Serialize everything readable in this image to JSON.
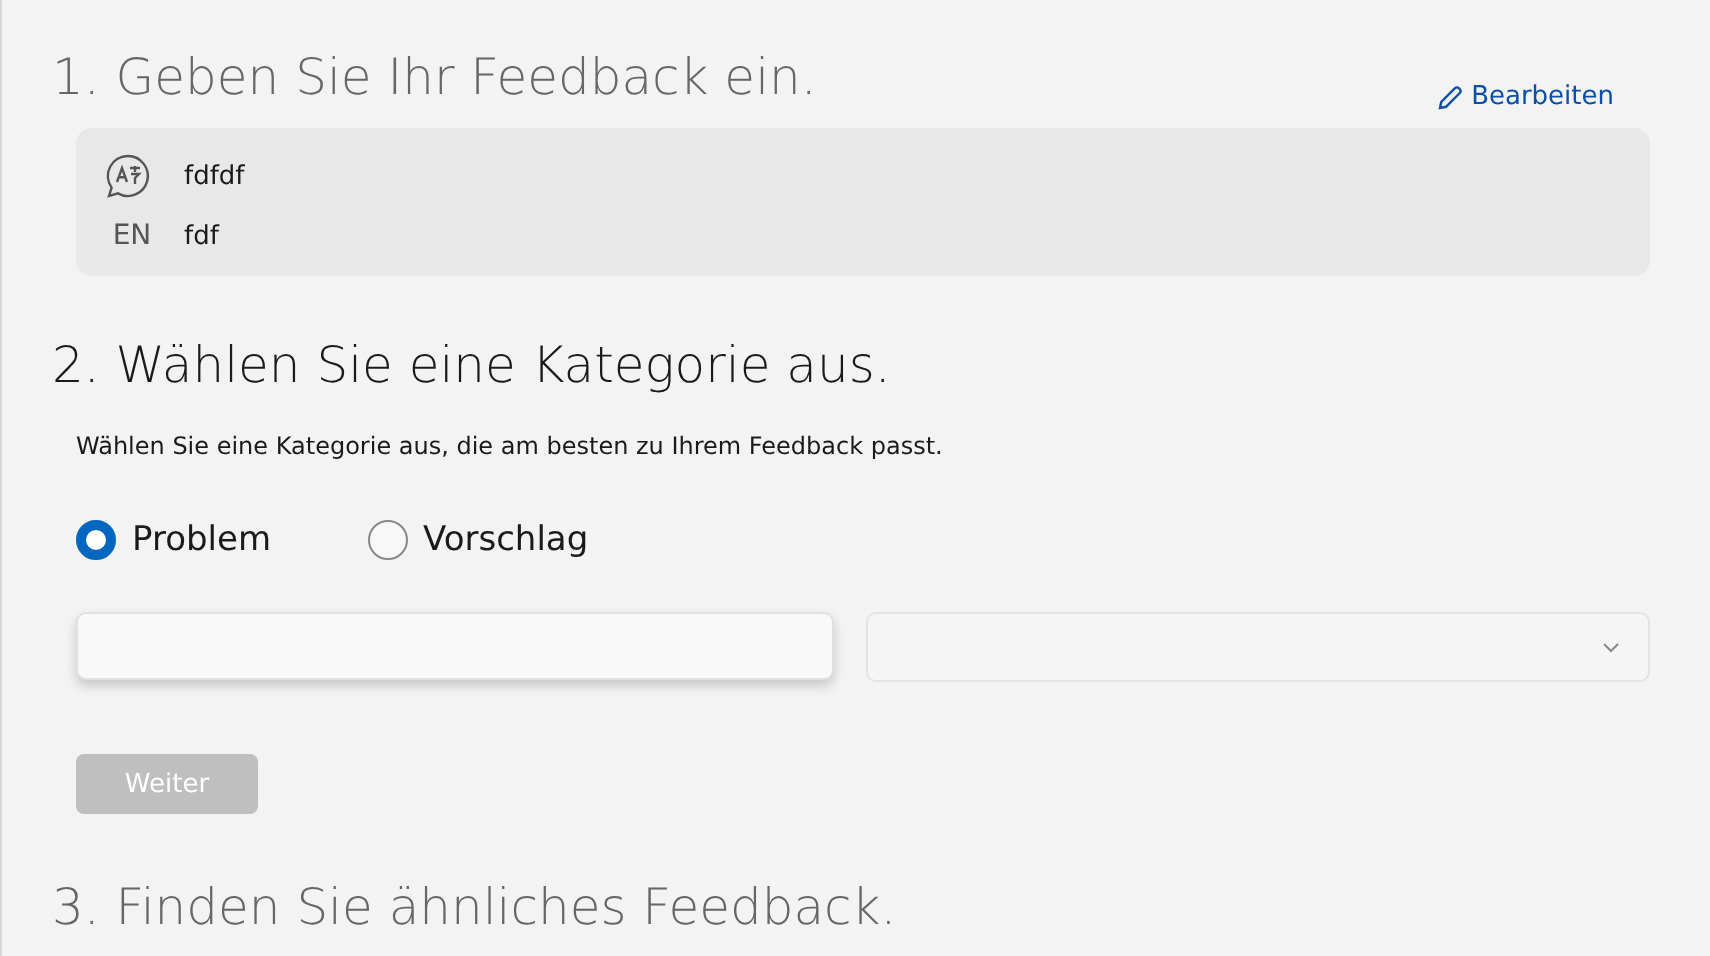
{
  "step1": {
    "heading": "1. Geben Sie Ihr Feedback ein.",
    "active": false,
    "edit_link": "Bearbeiten",
    "language": "EN",
    "title": "fdfdf",
    "description": "fdf"
  },
  "step2": {
    "heading": "2. Wählen Sie eine Kategorie aus.",
    "active": true,
    "instructions": "Wählen Sie eine Kategorie aus, die am besten zu Ihrem Feedback passt.",
    "options": [
      {
        "label": "Problem",
        "selected": true
      },
      {
        "label": "Vorschlag",
        "selected": false
      }
    ],
    "next_button": {
      "label": "Weiter",
      "disabled": true
    }
  },
  "step3": {
    "heading": "3. Finden Sie ähnliches Feedback.",
    "active": false
  }
}
